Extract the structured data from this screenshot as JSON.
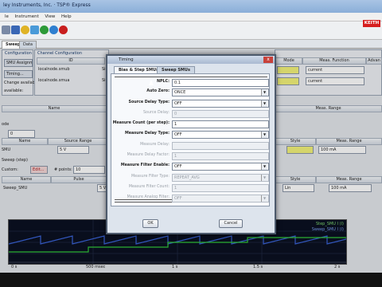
{
  "window": {
    "title": "ley Instruments, Inc. · TSP® Express",
    "brand": "KEITH"
  },
  "menubar": [
    "le",
    "Instrument",
    "View",
    "Help"
  ],
  "main_tabs": [
    "Sweep",
    "Data"
  ],
  "left_panel": {
    "header": "Configuration",
    "buttons": [
      "SMU Assignment...",
      "Timing..."
    ],
    "checks": [
      "Change available:",
      "available:"
    ]
  },
  "channel_panel": {
    "header": "Channel Configuration",
    "col_id": "ID",
    "rows": [
      "localnode.smub",
      "localnode.smua"
    ],
    "side": [
      "Sig",
      "Sig"
    ]
  },
  "measure_panel": {
    "headers": [
      "Mode",
      "Meas. Function",
      "Advan"
    ],
    "rows": [
      "current",
      "current"
    ]
  },
  "mid_headers": {
    "name": "Name",
    "range": "Meas. Range"
  },
  "smu_row": {
    "label": "ode",
    "value": "0"
  },
  "table2": {
    "headers": [
      "Name",
      "Source Range",
      "Style",
      "Meas. Range"
    ],
    "row": {
      "name": "SMU",
      "source": "5 V",
      "range": "100 mA"
    }
  },
  "sweep_step": {
    "label": "Sweep (step)",
    "custom": "Custom:",
    "edit": "Edit...",
    "points_label": "# points:",
    "points": "10",
    "table_headers": [
      "Name",
      "Pulse",
      "Style",
      "Meas. Range"
    ],
    "row": {
      "name": "Sweep_SMU",
      "source": "5 V",
      "style": "Lin",
      "range": "100 mA"
    }
  },
  "dialog": {
    "title": "Timing",
    "close": "x",
    "tabs": [
      "Bias & Step SMUs",
      "Sweep SMUs"
    ],
    "fields": [
      {
        "label": "NPLC:",
        "value": "0.1",
        "enabled": true,
        "dropdown": false
      },
      {
        "label": "Auto Zero:",
        "value": "ONCE",
        "enabled": true,
        "dropdown": true
      },
      {
        "label": "Source Delay Type:",
        "value": "OFF",
        "enabled": true,
        "dropdown": true
      },
      {
        "label": "Source Delay:",
        "value": "0",
        "enabled": false,
        "dropdown": false
      },
      {
        "label": "Measure Count (per step):",
        "value": "1",
        "enabled": true,
        "dropdown": false
      },
      {
        "label": "Measure Delay Type:",
        "value": "OFF",
        "enabled": true,
        "dropdown": true
      },
      {
        "label": "Measure Delay:",
        "value": "",
        "enabled": false,
        "dropdown": false
      },
      {
        "label": "Measure Delay Factor:",
        "value": "1",
        "enabled": false,
        "dropdown": false
      },
      {
        "label": "Measure Filter Enable:",
        "value": "OFF",
        "enabled": true,
        "dropdown": true
      },
      {
        "label": "Measure Filter Type:",
        "value": "REPEAT_AVG",
        "enabled": false,
        "dropdown": true
      },
      {
        "label": "Measure Filter Count:",
        "value": "1",
        "enabled": false,
        "dropdown": false
      },
      {
        "label": "Measure Analog Filter:",
        "value": "OFF",
        "enabled": false,
        "dropdown": true
      }
    ],
    "ok": "OK",
    "cancel": "Cancel"
  },
  "plot": {
    "legend": [
      "Step_SMU I (I)",
      "Sweep_SMU I (I)"
    ],
    "ticks": [
      "0 s",
      "500 msec",
      "1 s",
      "1.5 s",
      "2 s"
    ]
  }
}
